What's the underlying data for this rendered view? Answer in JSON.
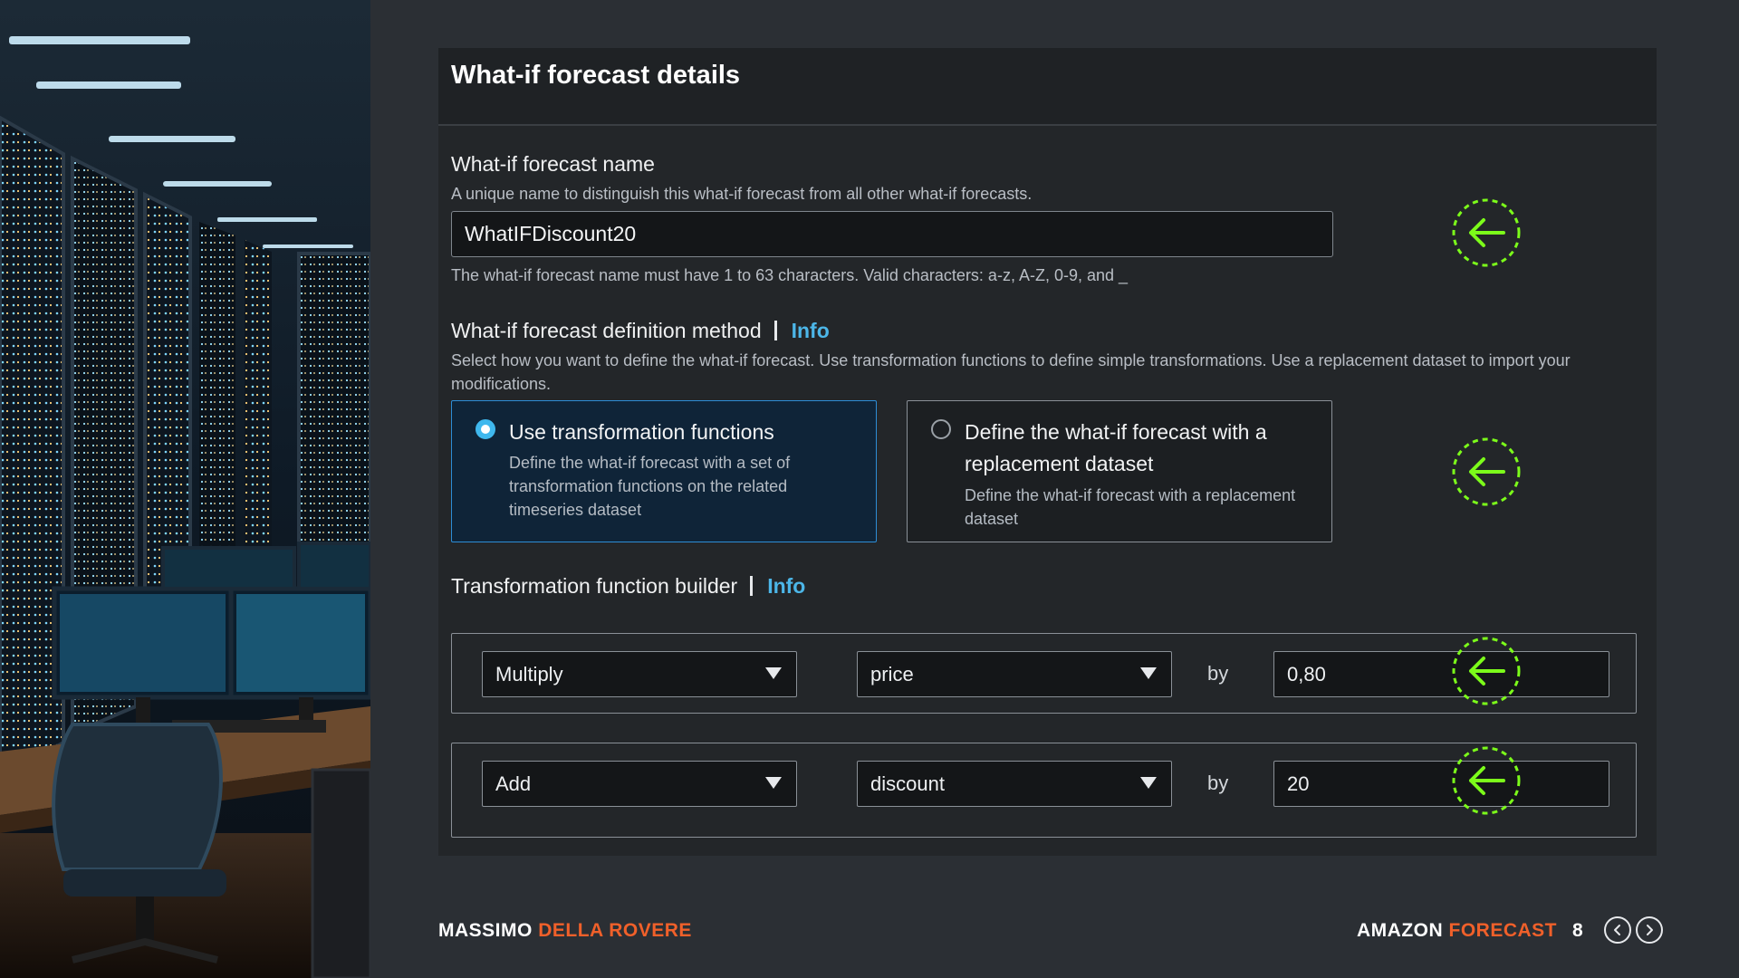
{
  "panel": {
    "title": "What-if forecast details",
    "name_field": {
      "label": "What-if forecast name",
      "description": "A unique name to distinguish this what-if forecast from all other what-if forecasts.",
      "value": "WhatIFDiscount20",
      "constraint": "The what-if forecast name must have 1 to 63 characters. Valid characters: a-z, A-Z, 0-9, and _"
    },
    "definition_method": {
      "label": "What-if forecast definition method",
      "info": "Info",
      "description": "Select how you want to define the what-if forecast. Use transformation functions to define simple transformations. Use a replacement dataset to import your modifications.",
      "options": [
        {
          "title": "Use transformation functions",
          "description": "Define the what-if forecast with a set of transformation functions on the related timeseries dataset",
          "selected": true
        },
        {
          "title": "Define the what-if forecast with a replacement dataset",
          "description": "Define the what-if forecast with a replacement dataset",
          "selected": false
        }
      ]
    },
    "builder": {
      "label": "Transformation function builder",
      "info": "Info",
      "rows": [
        {
          "operation": "Multiply",
          "attribute": "price",
          "by_label": "by",
          "value": "0,80"
        },
        {
          "operation": "Add",
          "attribute": "discount",
          "by_label": "by",
          "value": "20"
        }
      ]
    }
  },
  "footer": {
    "author_first": "MASSIMO",
    "author_last": "DELLA ROVERE",
    "brand_first": "AMAZON",
    "brand_second": "FORECAST",
    "page_number": "8"
  },
  "icons": {
    "marker": "dashed-circle-left-arrow-icon",
    "prev": "chevron-left-circle-icon",
    "next": "chevron-right-circle-icon"
  },
  "colors": {
    "background": "#2b2f34",
    "panel": "#232629",
    "info_link": "#4cb6e8",
    "selected_radio": "#3fb8ee",
    "marker_green": "#7cfc1a",
    "accent_orange": "#f0602a"
  }
}
